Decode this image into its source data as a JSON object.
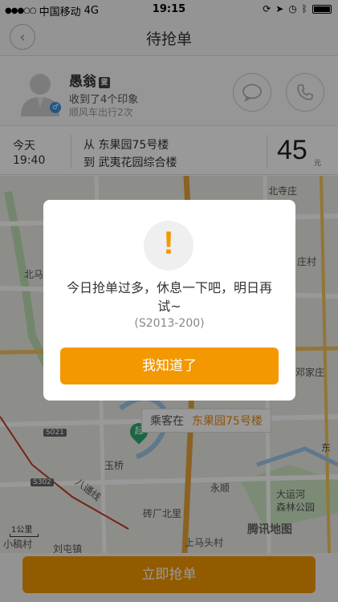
{
  "status_bar": {
    "carrier": "中国移动",
    "network": "4G",
    "time": "19:15"
  },
  "nav": {
    "title": "待抢单"
  },
  "passenger": {
    "name": "愚翁",
    "tag": "叟",
    "impressions": "收到了4个印象",
    "trips": "顺风车出行2次",
    "gender_symbol": "♂"
  },
  "trip": {
    "day": "今天",
    "time": "19:40",
    "from": "从 东果园75号楼",
    "to": "到 武夷花园综合楼",
    "price": "45",
    "price_unit": "元"
  },
  "map": {
    "labels": [
      "北寺庄",
      "北马房",
      "庄村",
      "邓家庄",
      "S021",
      "起",
      "玉桥",
      "S302",
      "八通线",
      "永顺",
      "大运河",
      "森林公园",
      "砖厂北里",
      "东",
      "上马头村",
      "小稿村",
      "刘屯镇",
      "1公里"
    ],
    "callout_prefix": "乘客在",
    "callout_destination": "东果园75号楼",
    "logo": "腾讯地图"
  },
  "action": {
    "grab_label": "立即抢单"
  },
  "dialog": {
    "icon": "!",
    "message": "今日抢单过多，休息一下吧，明日再试~",
    "code": "(S2013-200)",
    "button_label": "我知道了"
  },
  "colors": {
    "accent": "#f39800",
    "callout_destination": "#f08a0b",
    "pin": "#2fa86e"
  }
}
